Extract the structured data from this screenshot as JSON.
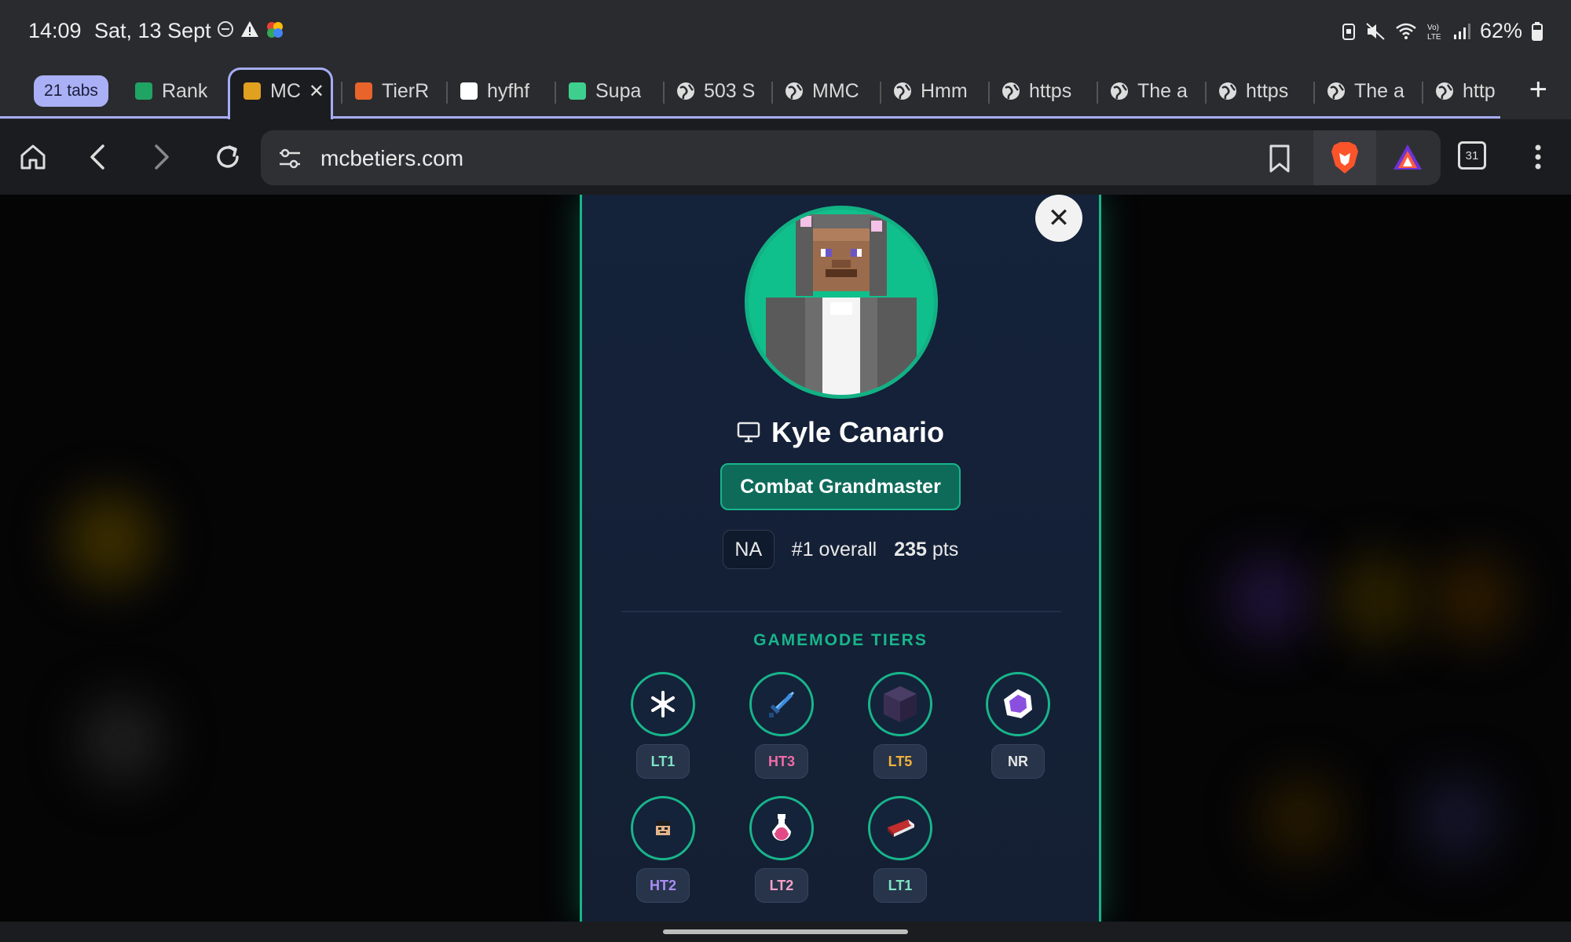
{
  "status_bar": {
    "time": "14:09",
    "date": "Sat, 13 Sept",
    "battery": "62%"
  },
  "tabs": {
    "count_label": "21 tabs",
    "items": [
      {
        "label": "Rank",
        "favicon": "sheets-icon",
        "color": "#1fa463"
      },
      {
        "label": "MC",
        "favicon": "mctiers-icon",
        "color": "#e0a020",
        "active": true
      },
      {
        "label": "TierR",
        "favicon": "tier-icon",
        "color": "#e8642a"
      },
      {
        "label": "hyfhf",
        "favicon": "github-icon",
        "color": "#ffffff"
      },
      {
        "label": "Supa",
        "favicon": "supabase-icon",
        "color": "#3ecf8e"
      },
      {
        "label": "503 S",
        "favicon": "globe-icon",
        "color": "#dddddd"
      },
      {
        "label": "MMC",
        "favicon": "globe-icon",
        "color": "#dddddd"
      },
      {
        "label": "Hmm",
        "favicon": "globe-icon",
        "color": "#dddddd"
      },
      {
        "label": "https",
        "favicon": "globe-icon",
        "color": "#dddddd"
      },
      {
        "label": "The a",
        "favicon": "globe-icon",
        "color": "#dddddd"
      },
      {
        "label": "https",
        "favicon": "globe-icon",
        "color": "#dddddd"
      },
      {
        "label": "The a",
        "favicon": "globe-icon",
        "color": "#dddddd"
      },
      {
        "label": "http",
        "favicon": "globe-icon",
        "color": "#dddddd"
      }
    ]
  },
  "toolbar": {
    "url": "mcbetiers.com",
    "tab_switcher_count": "31"
  },
  "profile": {
    "name": "Kyle Canario",
    "rank_title": "Combat Grandmaster",
    "region": "NA",
    "overall": "#1 overall",
    "points": "235",
    "points_unit": "pts",
    "section_title": "GAMEMODE TIERS",
    "accent_color": "#18b58a",
    "tiers": [
      {
        "icon": "snowflake-icon",
        "label": "LT1",
        "color": "#7fe3c4"
      },
      {
        "icon": "sword-icon",
        "label": "HT3",
        "color": "#f06ba8"
      },
      {
        "icon": "cube-icon",
        "label": "LT5",
        "color": "#f2b13a"
      },
      {
        "icon": "crystal-icon",
        "label": "NR",
        "color": "#e6e6e6"
      },
      {
        "icon": "face-icon",
        "label": "HT2",
        "color": "#a98cf5"
      },
      {
        "icon": "potion-icon",
        "label": "LT2",
        "color": "#f6a1c9"
      },
      {
        "icon": "bed-icon",
        "label": "LT1",
        "color": "#7fe3c4"
      }
    ]
  }
}
